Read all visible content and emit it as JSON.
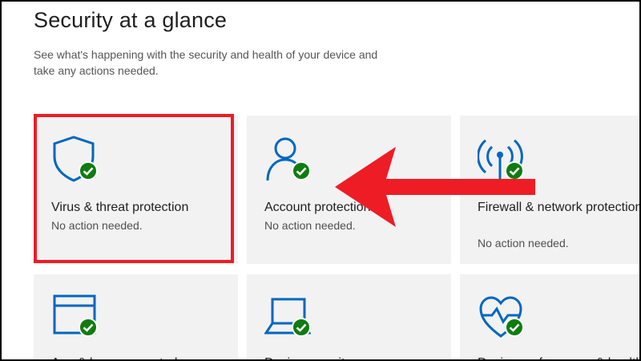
{
  "page": {
    "title": "Security at a glance",
    "subtitle": "See what's happening with the security and health of your device and take any actions needed."
  },
  "tiles": [
    {
      "title": "Virus & threat protection",
      "status": "No action needed.",
      "icon": "shield-icon"
    },
    {
      "title": "Account protection",
      "status": "No action needed.",
      "icon": "person-icon"
    },
    {
      "title": "Firewall & network protection",
      "status": "No action needed.",
      "icon": "antenna-icon"
    },
    {
      "title": "App & browser control",
      "status": "",
      "icon": "browser-window-icon"
    },
    {
      "title": "Device security",
      "status": "",
      "icon": "laptop-icon"
    },
    {
      "title": "Device performance & health",
      "status": "",
      "icon": "heart-pulse-icon"
    }
  ],
  "colors": {
    "accent_blue": "#0067c0",
    "check_green": "#107c10",
    "highlight_red": "#ee1c25",
    "tile_background": "#f2f2f2"
  }
}
